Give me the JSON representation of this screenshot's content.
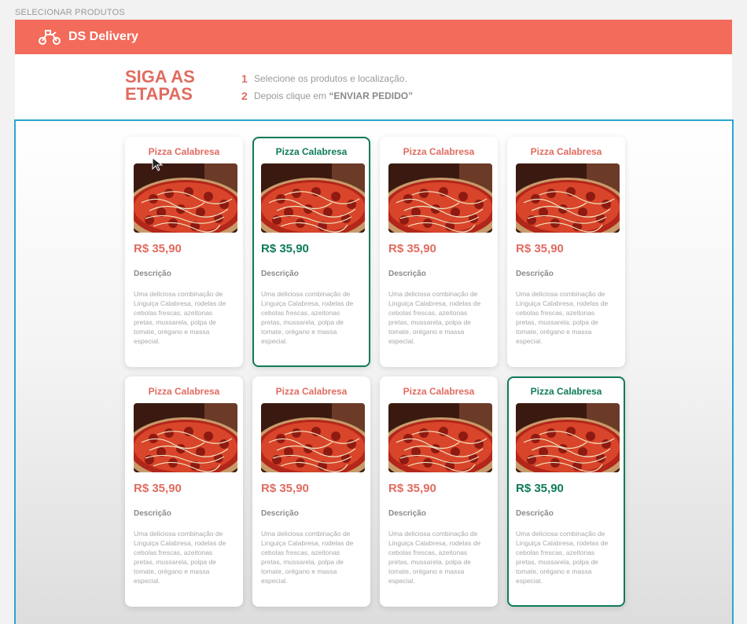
{
  "page_label": "SELECIONAR PRODUTOS",
  "navbar": {
    "brand": "DS Delivery",
    "icon": "delivery-scooter-icon",
    "color": "#f26b5b"
  },
  "steps": {
    "title": "SIGA AS ETAPAS",
    "items": [
      {
        "num": "1",
        "text": "Selecione os produtos e localização."
      },
      {
        "num": "2",
        "text_prefix": "Depois clique em ",
        "text_bold": "“ENVIAR PEDIDO”"
      }
    ]
  },
  "colors": {
    "accent": "#e06c60",
    "selected": "#0f7b5c",
    "products_border": "#2aa6d3"
  },
  "products": [
    {
      "name": "Pizza Calabresa",
      "price": "R$ 35,90",
      "desc_label": "Descrição",
      "description": "Uma deliciosa combinação de Linguiça Calabresa, rodelas de cebolas frescas, azeitonas pretas, mussarela, polpa de tomate, orégano e massa especial.",
      "selected": false
    },
    {
      "name": "Pizza Calabresa",
      "price": "R$ 35,90",
      "desc_label": "Descrição",
      "description": "Uma deliciosa combinação de Linguiça Calabresa, rodelas de cebolas frescas, azeitonas pretas, mussarela, polpa de tomate, orégano e massa especial.",
      "selected": true
    },
    {
      "name": "Pizza Calabresa",
      "price": "R$ 35,90",
      "desc_label": "Descrição",
      "description": "Uma deliciosa combinação de Linguiça Calabresa, rodelas de cebolas frescas, azeitonas pretas, mussarela, polpa de tomate, orégano e massa especial.",
      "selected": false
    },
    {
      "name": "Pizza Calabresa",
      "price": "R$ 35,90",
      "desc_label": "Descrição",
      "description": "Uma deliciosa combinação de Linguiça Calabresa, rodelas de cebolas frescas, azeitonas pretas, mussarela, polpa de tomate, orégano e massa especial.",
      "selected": false
    },
    {
      "name": "Pizza Calabresa",
      "price": "R$ 35,90",
      "desc_label": "Descrição",
      "description": "Uma deliciosa combinação de Linguiça Calabresa, rodelas de cebolas frescas, azeitonas pretas, mussarela, polpa de tomate, orégano e massa especial.",
      "selected": false
    },
    {
      "name": "Pizza Calabresa",
      "price": "R$ 35,90",
      "desc_label": "Descrição",
      "description": "Uma deliciosa combinação de Linguiça Calabresa, rodelas de cebolas frescas, azeitonas pretas, mussarela, polpa de tomate, orégano e massa especial.",
      "selected": false
    },
    {
      "name": "Pizza Calabresa",
      "price": "R$ 35,90",
      "desc_label": "Descrição",
      "description": "Uma deliciosa combinação de Linguiça Calabresa, rodelas de cebolas frescas, azeitonas pretas, mussarela, polpa de tomate, orégano e massa especial.",
      "selected": false
    },
    {
      "name": "Pizza Calabresa",
      "price": "R$ 35,90",
      "desc_label": "Descrição",
      "description": "Uma deliciosa combinação de Linguiça Calabresa, rodelas de cebolas frescas, azeitonas pretas, mussarela, polpa de tomate, orégano e massa especial.",
      "selected": true
    }
  ]
}
